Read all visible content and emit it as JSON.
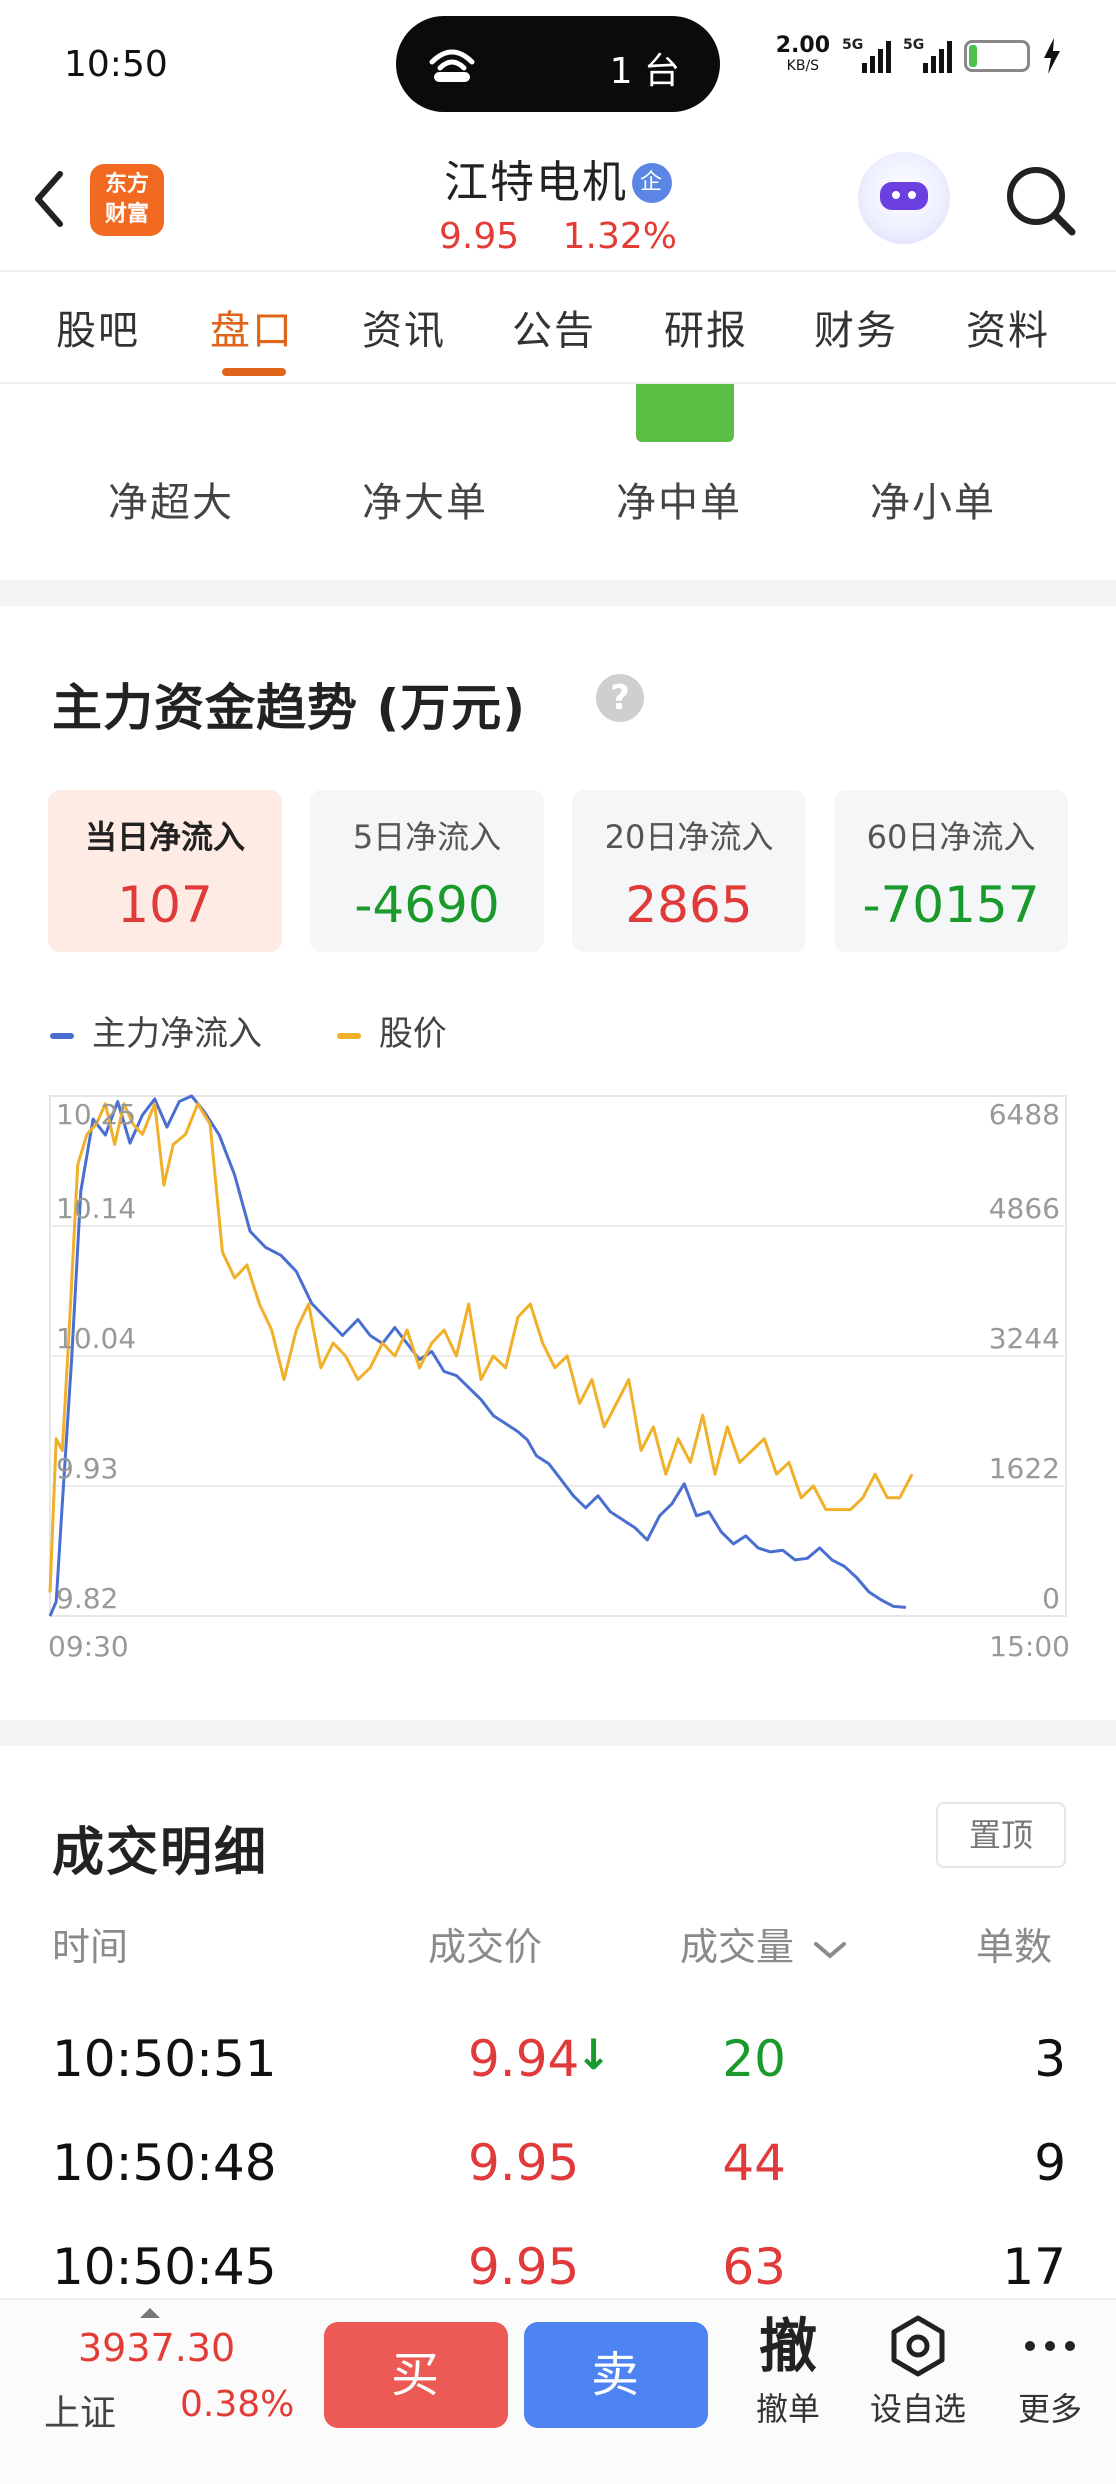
{
  "status_bar": {
    "time": "10:50",
    "island_text": "1 台",
    "net_speed": "2.00",
    "net_unit": "KB/S",
    "signal_1": "5G",
    "signal_2": "5G",
    "battery": "14",
    "battery_level": 0.14
  },
  "header": {
    "brand": [
      "东方",
      "财富"
    ],
    "stock_name": "江特电机",
    "badge": "企",
    "price": "9.95",
    "change_pct": "1.32%"
  },
  "tabs": [
    {
      "label": "股吧"
    },
    {
      "label": "盘口",
      "active": true
    },
    {
      "label": "资讯"
    },
    {
      "label": "公告"
    },
    {
      "label": "研报"
    },
    {
      "label": "财务"
    },
    {
      "label": "资料"
    }
  ],
  "flow_categories": [
    "净超大",
    "净大单",
    "净中单",
    "净小单"
  ],
  "trend": {
    "title": "主力资金趋势 (万元)",
    "help": "?",
    "cards": [
      {
        "label": "当日净流入",
        "value": "107",
        "dir": "up",
        "active": true
      },
      {
        "label": "5日净流入",
        "value": "-4690",
        "dir": "down"
      },
      {
        "label": "20日净流入",
        "value": "2865",
        "dir": "up"
      },
      {
        "label": "60日净流入",
        "value": "-70157",
        "dir": "down"
      }
    ],
    "legend": [
      {
        "label": "主力净流入",
        "color": "#4a6fd0"
      },
      {
        "label": "股价",
        "color": "#f0b02a"
      }
    ]
  },
  "chart_data": {
    "type": "line",
    "x_start": "09:30",
    "x_end": "15:00",
    "left_axis_ticks": [
      "10.25",
      "10.14",
      "10.04",
      "9.93",
      "9.82"
    ],
    "right_axis_ticks": [
      "6488",
      "4866",
      "3244",
      "1622",
      "0"
    ],
    "x_ticks": [
      "09:30",
      "15:00"
    ],
    "series": [
      {
        "name": "主力净流入",
        "color": "#4a6fd0",
        "axis": "right",
        "x_minutes": [
          0,
          2,
          4,
          7,
          10,
          14,
          18,
          22,
          26,
          30,
          34,
          38,
          42,
          46,
          50,
          55,
          60,
          65,
          70,
          75,
          80,
          85,
          90,
          95,
          100,
          104,
          108,
          112,
          116,
          120,
          124,
          128,
          132,
          136,
          140,
          144,
          148,
          152,
          155,
          158,
          162,
          166,
          170,
          174,
          178,
          182,
          186,
          190,
          194,
          198,
          202,
          206,
          210,
          214,
          218,
          222,
          226,
          230,
          234,
          238,
          242,
          246,
          250,
          254,
          258,
          262,
          266,
          270,
          274,
          278
        ],
        "values": [
          0,
          180,
          1400,
          3200,
          5300,
          6200,
          6000,
          6420,
          5900,
          6250,
          6450,
          6100,
          6420,
          6488,
          6300,
          6000,
          5500,
          4800,
          4600,
          4500,
          4300,
          3900,
          3700,
          3500,
          3700,
          3500,
          3400,
          3600,
          3400,
          3200,
          3300,
          3050,
          3000,
          2850,
          2700,
          2500,
          2400,
          2300,
          2200,
          2000,
          1900,
          1700,
          1500,
          1350,
          1500,
          1300,
          1200,
          1100,
          950,
          1250,
          1400,
          1650,
          1250,
          1300,
          1050,
          900,
          1000,
          850,
          800,
          820,
          700,
          720,
          850,
          700,
          620,
          480,
          300,
          200,
          120,
          107
        ]
      },
      {
        "name": "股价",
        "color": "#f0b02a",
        "axis": "left",
        "x_minutes": [
          0,
          2,
          4,
          6,
          9,
          12,
          15,
          18,
          21,
          24,
          27,
          30,
          34,
          37,
          40,
          44,
          48,
          52,
          56,
          60,
          64,
          68,
          72,
          76,
          80,
          84,
          88,
          92,
          96,
          100,
          104,
          108,
          112,
          116,
          120,
          124,
          128,
          132,
          136,
          140,
          144,
          148,
          152,
          156,
          160,
          164,
          168,
          172,
          176,
          180,
          184,
          188,
          192,
          196,
          200,
          204,
          208,
          212,
          216,
          220,
          224,
          228,
          232,
          236,
          240,
          244,
          248,
          252,
          256,
          260,
          264,
          268,
          272,
          276,
          280
        ],
        "values": [
          9.84,
          9.97,
          9.96,
          10.05,
          10.2,
          10.23,
          10.24,
          10.26,
          10.22,
          10.26,
          10.24,
          10.23,
          10.26,
          10.18,
          10.22,
          10.23,
          10.26,
          10.24,
          10.12,
          10.1,
          10.11,
          10.08,
          10.06,
          10.02,
          10.06,
          10.08,
          10.03,
          10.05,
          10.04,
          10.02,
          10.03,
          10.05,
          10.04,
          10.06,
          10.03,
          10.05,
          10.06,
          10.04,
          10.08,
          10.02,
          10.04,
          10.03,
          10.07,
          10.08,
          10.05,
          10.03,
          10.04,
          10.0,
          10.02,
          9.98,
          10.0,
          10.02,
          9.96,
          9.98,
          9.94,
          9.97,
          9.95,
          9.99,
          9.94,
          9.98,
          9.95,
          9.96,
          9.97,
          9.94,
          9.95,
          9.92,
          9.93,
          9.91,
          9.91,
          9.91,
          9.92,
          9.94,
          9.92,
          9.92,
          9.94
        ]
      }
    ]
  },
  "details": {
    "title": "成交明细",
    "pin": "置顶",
    "headers": [
      "时间",
      "成交价",
      "成交量",
      "单数"
    ],
    "rows": [
      {
        "time": "10:50:51",
        "price": "9.94",
        "volume": "20",
        "count": "3",
        "price_dir": "up",
        "vol_dir": "down",
        "arrow": "↓"
      },
      {
        "time": "10:50:48",
        "price": "9.95",
        "volume": "44",
        "count": "9",
        "price_dir": "up",
        "vol_dir": "up",
        "arrow": ""
      },
      {
        "time": "10:50:45",
        "price": "9.95",
        "volume": "63",
        "count": "17",
        "price_dir": "up",
        "vol_dir": "up",
        "arrow": ""
      }
    ]
  },
  "bottom": {
    "index_value": "3937.30",
    "index_name": "上证",
    "index_change": "0.38%",
    "buy": "买",
    "sell": "卖",
    "tools": [
      {
        "glyph": "撤",
        "label": "撤单"
      },
      {
        "label": "设自选"
      },
      {
        "label": "更多"
      }
    ]
  },
  "colors": {
    "accent": "#e0651b",
    "up": "#e03a3a",
    "down": "#1a9a2b",
    "buy": "#ec5a55",
    "sell": "#4d84f2"
  }
}
